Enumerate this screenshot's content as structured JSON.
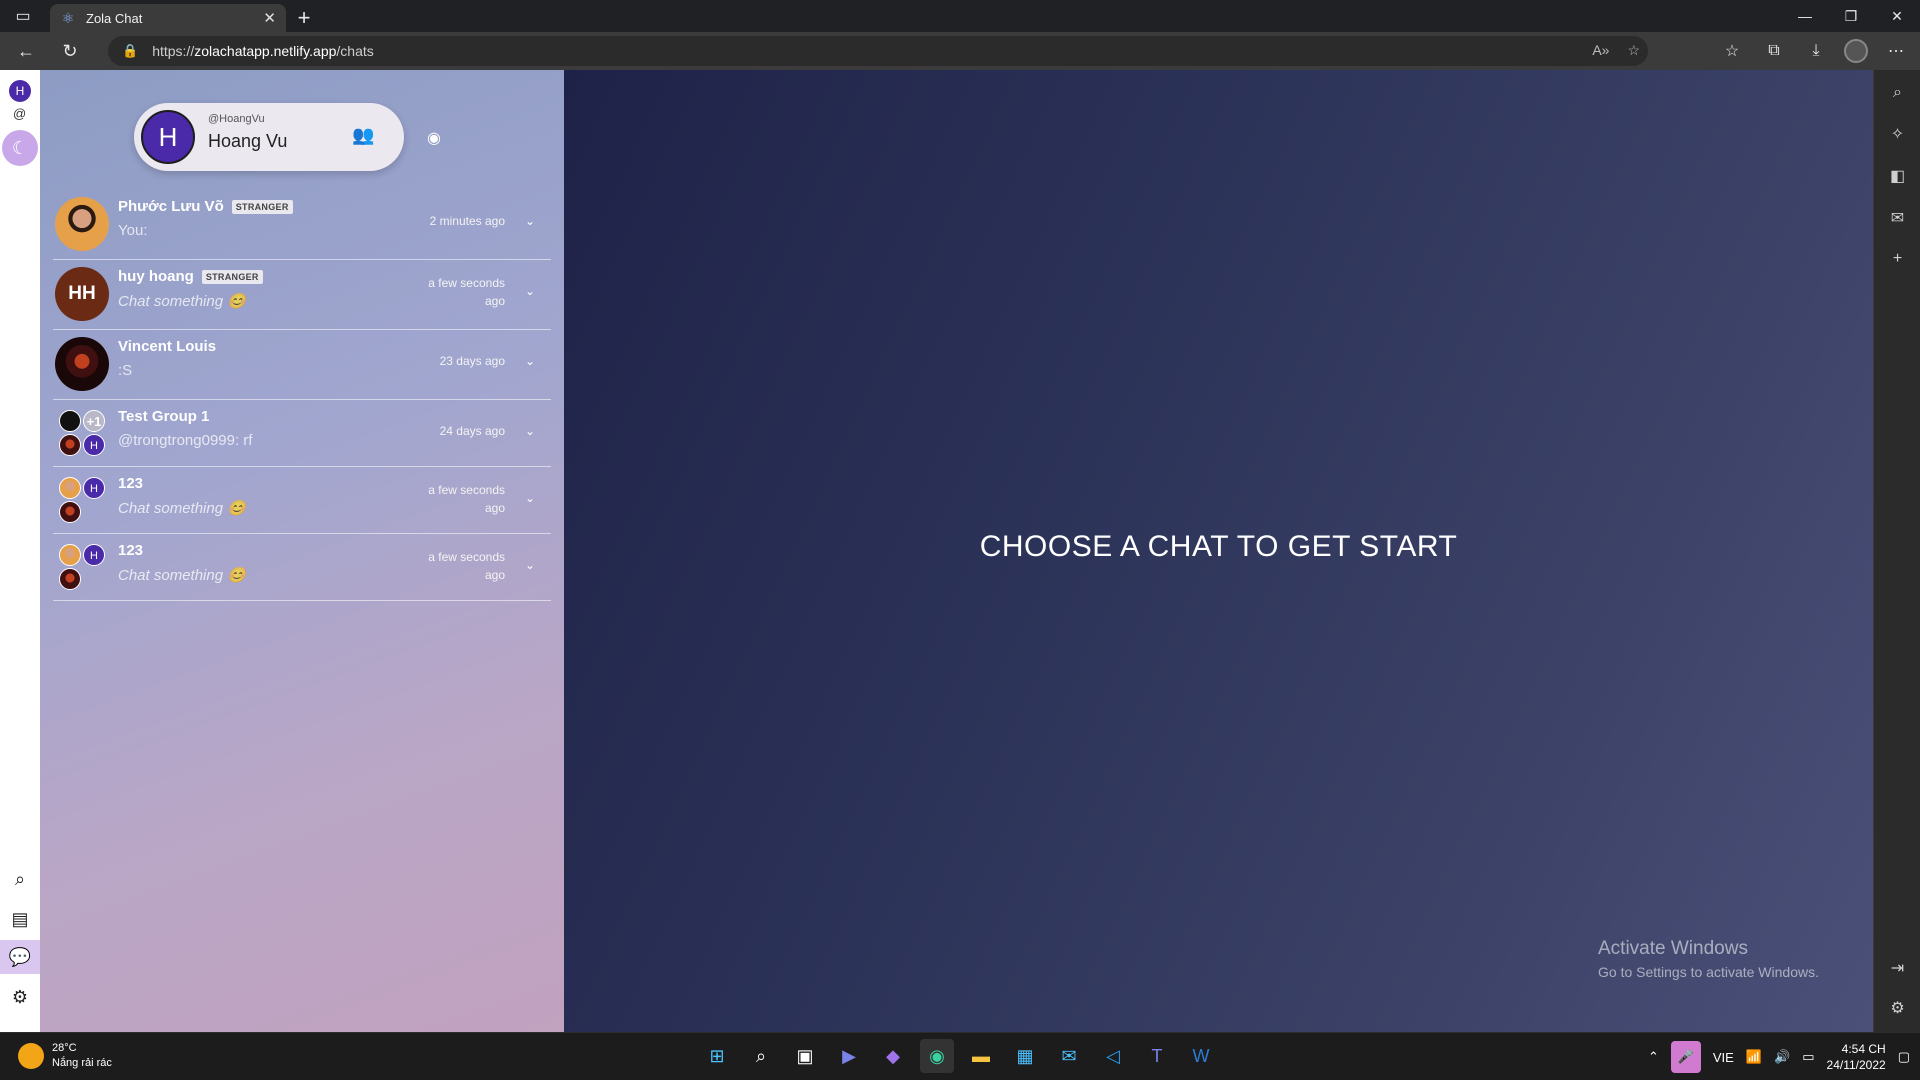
{
  "browser": {
    "tab_title": "Zola Chat",
    "url_prefix": "https://",
    "url_host": "zolachatapp.netlify.app",
    "url_path": "/chats"
  },
  "profile": {
    "avatar_letter": "H",
    "handle": "@HoangVu",
    "name": "Hoang Vu"
  },
  "chats": [
    {
      "name": "Phước Lưu Võ",
      "badge": "STRANGER",
      "preview": "You:",
      "time": "2 minutes ago"
    },
    {
      "name": "huy hoang",
      "badge": "STRANGER",
      "avatar_text": "HH",
      "preview": "Chat something 😊",
      "time_line1": "a few seconds",
      "time_line2": "ago"
    },
    {
      "name": "Vincent Louis",
      "preview": ":S",
      "time": "23 days ago"
    },
    {
      "name": "Test Group 1",
      "extra_count": "+1",
      "mini_h": "H",
      "preview": "@trongtrong0999: rf",
      "time": "24 days ago"
    },
    {
      "name": "123",
      "mini_h": "H",
      "preview": "Chat something 😊",
      "time_line1": "a few seconds",
      "time_line2": "ago"
    },
    {
      "name": "123",
      "mini_h": "H",
      "preview": "Chat something 😊",
      "time_line1": "a few seconds",
      "time_line2": "ago"
    }
  ],
  "main": {
    "placeholder": "CHOOSE A CHAT TO GET START"
  },
  "watermark": {
    "title": "Activate Windows",
    "subtitle": "Go to Settings to activate Windows."
  },
  "taskbar": {
    "temperature": "28°C",
    "weather": "Nắng rải rác",
    "language": "VIE",
    "time": "4:54 CH",
    "date": "24/11/2022"
  },
  "colors": {
    "accent_purple": "#4a2aa8",
    "chatlist_gradient_start": "#8d9cc4",
    "main_bg": "#2c3358"
  }
}
